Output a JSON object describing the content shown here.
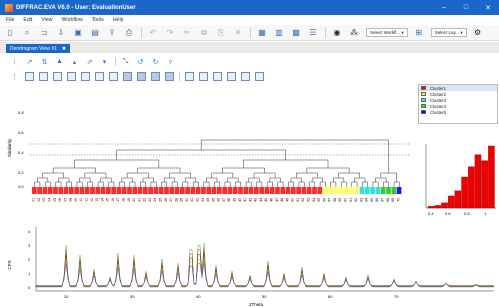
{
  "window": {
    "title": "DIFFRAC.EVA V6.0 - User: EvaluationUser",
    "min": "–",
    "max": "□",
    "close": "✕"
  },
  "menu": [
    "File",
    "Edit",
    "View",
    "Workflow",
    "Tools",
    "Help"
  ],
  "toolbar": {
    "workflow_dropdown": "Select Workfl... ▾",
    "layout_dropdown": "Select Lay... ▾"
  },
  "doc_tab": {
    "label": "Dendrogram View #1",
    "pin": "✖"
  },
  "dendrogram": {
    "ylabel": "Similarity",
    "yticks": [
      "0,8",
      "0,6",
      "0,4",
      "0,2",
      "0,0",
      "1,0"
    ],
    "leaf_labels": [
      "01",
      "02",
      "03",
      "04",
      "05",
      "06",
      "07",
      "08",
      "09",
      "10",
      "11",
      "12",
      "13",
      "14",
      "15",
      "16",
      "17",
      "18",
      "19",
      "20",
      "21",
      "22",
      "23",
      "24",
      "25",
      "26",
      "27",
      "28",
      "29",
      "30",
      "31",
      "32",
      "33",
      "34",
      "35",
      "36",
      "37",
      "38",
      "39",
      "40",
      "41",
      "42",
      "43",
      "44",
      "45",
      "46",
      "47",
      "48",
      "49",
      "50",
      "51",
      "52",
      "53",
      "54",
      "55",
      "56",
      "57",
      "58",
      "59",
      "60",
      "61",
      "62",
      "63",
      "64",
      "65",
      "66",
      "67",
      "68",
      "69",
      "70"
    ],
    "colors": {
      "red": "#ff2a2a",
      "yellow": "#ffff66",
      "cyan": "#33e0e0",
      "green": "#33cc33",
      "blue": "#1a1aff"
    }
  },
  "legend": {
    "items": [
      {
        "label": "Cluster1",
        "color": "#ff0000"
      },
      {
        "label": "Cluster2",
        "color": "#ffff00"
      },
      {
        "label": "Cluster3",
        "color": "#00ffff"
      },
      {
        "label": "Cluster4",
        "color": "#00ff00"
      },
      {
        "label": "Cluster5",
        "color": "#0000ff"
      }
    ]
  },
  "histogram": {
    "xticks": [
      "0.4",
      "0.6",
      "0.8",
      "1"
    ],
    "color": "#ee0000",
    "values": [
      2,
      3,
      6,
      14,
      20,
      36,
      48,
      62,
      55,
      72
    ]
  },
  "xrd": {
    "ylabel": "CPS",
    "xlabel": "2Theta",
    "yticks": [
      "4",
      "3",
      "2",
      "1",
      "0"
    ],
    "xticks": [
      "20",
      "30",
      "40",
      "50",
      "60",
      "70"
    ]
  }
}
